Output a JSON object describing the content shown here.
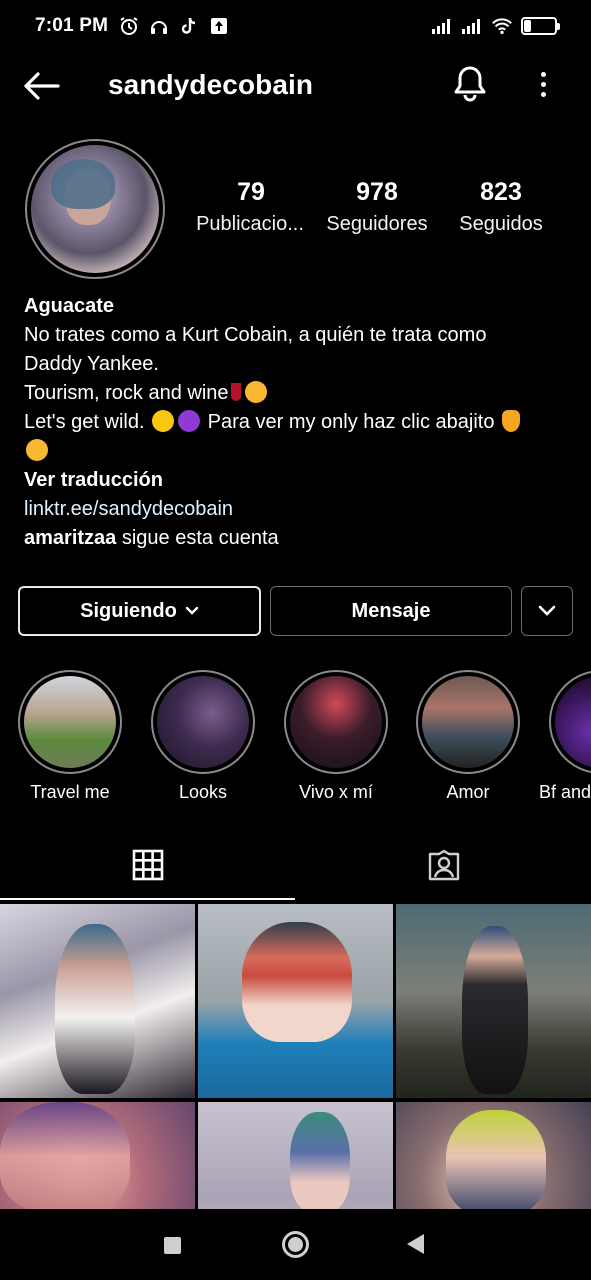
{
  "status_bar": {
    "time": "7:01 PM",
    "left_icons": [
      "alarm-icon",
      "headset-icon",
      "tiktok-icon",
      "upload-icon"
    ],
    "right_icons": [
      "signal-icon",
      "signal-icon",
      "wifi-icon"
    ],
    "battery": "23",
    "battery_level": 0.23
  },
  "header": {
    "username": "sandydecobain",
    "icons": [
      "back-arrow-icon",
      "bell-icon",
      "more-vertical-icon"
    ]
  },
  "stats": {
    "posts_count": "79",
    "posts_label": "Publicacio...",
    "followers_count": "978",
    "followers_label": "Seguidores",
    "following_count": "823",
    "following_label": "Seguidos"
  },
  "bio": {
    "name": "Aguacate",
    "line1": "No trates como a Kurt Cobain, a quién te trata como",
    "line2": "Daddy Yankee.",
    "line3": "Tourism, rock and wine",
    "line4a": "Let's get wild.",
    "line4b": "Para ver my only haz clic abajito",
    "translate": "Ver traducción",
    "link": "linktr.ee/sandydecobain",
    "follower_user": "amaritzaa",
    "follower_text": "sigue esta cuenta"
  },
  "actions": {
    "following": "Siguiendo",
    "message": "Mensaje"
  },
  "highlights": [
    {
      "label": "Travel me"
    },
    {
      "label": "Looks"
    },
    {
      "label": "Vivo x mí"
    },
    {
      "label": "Amor"
    },
    {
      "label": "Bf and"
    }
  ],
  "tabs": {
    "icons": [
      "grid-icon",
      "tagged-person-icon"
    ],
    "active": "grid"
  },
  "colors": {
    "background": "#000000",
    "text": "#ffffff",
    "border": "#6a6a6a",
    "link": "#e0f1ff"
  }
}
